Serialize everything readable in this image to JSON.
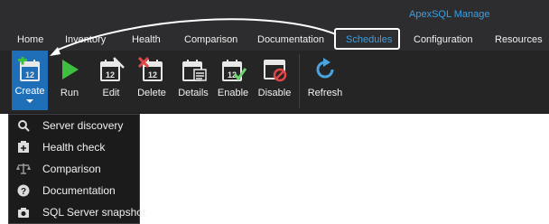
{
  "app_title": "ApexSQL Manage",
  "tabs": [
    {
      "label": "Home",
      "icon": ""
    },
    {
      "label": "Inventory"
    },
    {
      "label": "Health"
    },
    {
      "label": "Comparison"
    },
    {
      "label": "Documentation"
    },
    {
      "label": "Schedules"
    },
    {
      "label": "Configuration"
    },
    {
      "label": "Resources"
    }
  ],
  "active_tab": "Schedules",
  "ribbon": {
    "create": {
      "label": "Create",
      "icon": "calendar-add-icon"
    },
    "run": {
      "label": "Run",
      "icon": "play-icon"
    },
    "edit": {
      "label": "Edit",
      "icon": "calendar-edit-icon"
    },
    "delete": {
      "label": "Delete",
      "icon": "calendar-delete-icon"
    },
    "details": {
      "label": "Details",
      "icon": "calendar-details-icon"
    },
    "enable": {
      "label": "Enable",
      "icon": "calendar-enable-icon"
    },
    "disable": {
      "label": "Disable",
      "icon": "calendar-disable-icon"
    },
    "refresh": {
      "label": "Refresh",
      "icon": "refresh-icon"
    }
  },
  "calendar_day": "12",
  "create_menu": [
    {
      "label": "Server discovery",
      "icon": "search-icon"
    },
    {
      "label": "Health check",
      "icon": "health-icon"
    },
    {
      "label": "Comparison",
      "icon": "scale-icon"
    },
    {
      "label": "Documentation",
      "icon": "question-icon"
    },
    {
      "label": "SQL Server snapshot",
      "icon": "snapshot-icon"
    }
  ],
  "colors": {
    "accent": "#3aa0e6",
    "create_button": "#1e6fb8",
    "dark_bg": "#2d2d30",
    "ribbon_bg": "#252526",
    "run_green": "#3fbf3f",
    "delete_red": "#e04848",
    "enable_green": "#6fd46f",
    "refresh_blue": "#4aa3df"
  }
}
